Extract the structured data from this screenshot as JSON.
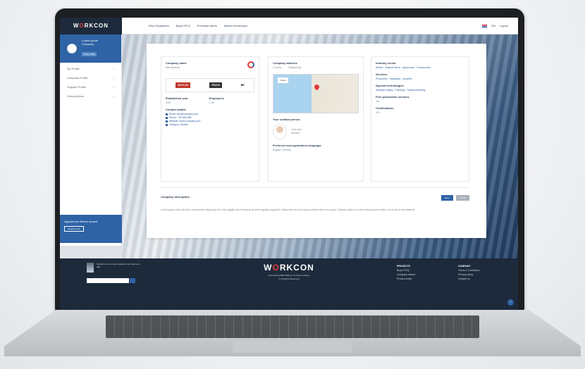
{
  "app": {
    "logo": "WORKCON"
  },
  "nav": [
    "Who Registered",
    "Buyer RFQ",
    "Purchase Alerts",
    "Market Information"
  ],
  "lang": {
    "code": "EN",
    "logout": "Logout"
  },
  "sidebar": {
    "profile_name": "Lorem ipsum",
    "profile_sub": "Company",
    "profile_btn": "View profile",
    "items": [
      "My Profile",
      "Company Profile",
      "Supplier Profile",
      "Subscriptions"
    ],
    "promo_text": "Upgrade your Worcon account",
    "promo_btn": "Upgrade now"
  },
  "company": {
    "title": "Company name",
    "subtitle": "Manufacturer",
    "brand1": "ROYLOK",
    "brand2": "TRUCK",
    "brand3": "BE",
    "established_label": "Established year",
    "established_value": "2007",
    "employees_label": "Employees",
    "employees_value": "1-50",
    "details_title": "Contact details",
    "email": "Email: info@company.com",
    "phone": "Phone: +90 555 555",
    "website": "Website: www.company.com",
    "category": "Category: Marble"
  },
  "address": {
    "title": "Company address",
    "country": "Country",
    "region": "Region/City",
    "map_label": "Turkey",
    "person_title": "Your contact person",
    "person_name": "John Doe",
    "person_role": "Director",
    "lang_title": "Preferred correspondence language",
    "lang_value": "English, German"
  },
  "sectors": {
    "title": "Industry sector",
    "sector_value": "Marble · Natural Stone · Agriculture · Construction",
    "services_title": "Services",
    "services_value": "Production · Marketing · Quarries",
    "special_title": "Special technologies",
    "special_value": "Waterjet cutting · Polishing · Surface finishing",
    "free_title": "Free production services",
    "free_value": "Yes",
    "cert_title": "Certifications",
    "cert_value": "ISO"
  },
  "about": {
    "title": "Company description",
    "save": "Save",
    "cancel": "Cancel",
    "text": "Lorem ipsum dolor sit amet, consectetur adipiscing elit. Duis sagittis nisi et tempus sit amet egestas dignissim. Maecenas nec sed lectus porttitor libero ut cursus. Vivamus ullam a sit amet aliquet ipsum libero. Ut at nisl ut erat eleifend."
  },
  "footer": {
    "news": "Subscribe to our free newsletter and stay up to date",
    "input_placeholder": "Email",
    "logo": "WORKCON",
    "tagline": "International B2B Platform for Stone Industry",
    "copyright": "© All Rights Reserved",
    "col1_title": "PROJECTS",
    "col1_items": [
      "Buyer RFQ",
      "Company search",
      "Product Index"
    ],
    "col2_title": "COMPANY",
    "col2_items": [
      "Terms & Conditions",
      "Privacy policy",
      "Contact us"
    ]
  },
  "colors": {
    "primary": "#2e63a6",
    "dark": "#1c2a3c",
    "accent": "#e23a3a"
  }
}
